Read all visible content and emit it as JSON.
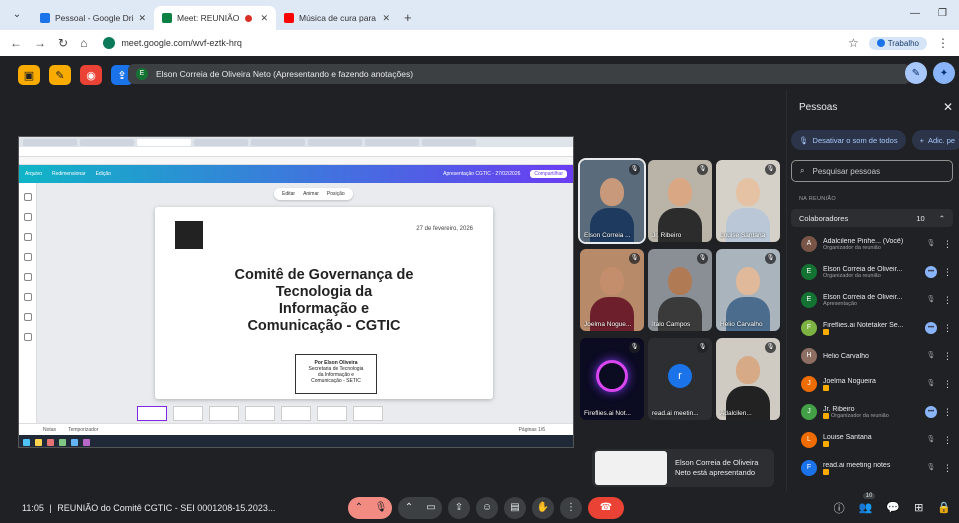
{
  "browser": {
    "tabs": [
      {
        "label": "Pessoal - Google Drive",
        "active": false,
        "color": "#1a73e8"
      },
      {
        "label": "Meet: REUNIÃO do Comitê",
        "active": true,
        "color": "#0b8043"
      },
      {
        "label": "Música de cura para o coração",
        "active": false,
        "color": "#ff0000"
      }
    ],
    "url": "meet.google.com/wvf-eztk-hrq",
    "profile_label": "Trabalho"
  },
  "meet": {
    "presenter_banner": "Elson Correia de Oliveira Neto (Apresentando e fazendo anotações)",
    "presenter_initial": "E",
    "presenting_card": {
      "line1": "Elson Correia de Oliveira",
      "line2": "Neto está apresentando"
    },
    "meeting_time": "11:05",
    "meeting_title": "REUNIÃO do Comitê CGTIC - SEI 0001208-15.2023...",
    "people_badge": "10"
  },
  "slide": {
    "date": "27 de fevereiro, 2026",
    "title_lines": [
      "Comitê de Governança de",
      "Tecnologia da",
      "Informação e",
      "Comunicação - CGTIC"
    ],
    "box_lines": [
      "Por Elson Oliveira",
      "Secretaria de Tecnologia",
      "da Informação e",
      "Comunicação - SETIC"
    ],
    "tools": [
      "Editar",
      "Animar",
      "Posição"
    ],
    "status_left": [
      "Notas",
      "Temporizador"
    ],
    "status_right": "Páginas 1/6",
    "canva_menu": [
      "Arquivo",
      "Redimensionar",
      "Edição"
    ],
    "canva_doc": "Apresentação CGTIC - 27/02/2026",
    "canva_share": "Compartilhar"
  },
  "tiles": [
    {
      "name": "Elson Correia ...",
      "sel": true,
      "bg": "#5a6b7c",
      "skin": "#c8997a",
      "shirt": "#1e3a5f"
    },
    {
      "name": "Jr. Ribeiro",
      "sel": false,
      "bg": "#b9b3a8",
      "skin": "#d9a784",
      "shirt": "#2c2c2c"
    },
    {
      "name": "Louise Santana",
      "sel": false,
      "bg": "#d5d0c8",
      "skin": "#e6c2a5",
      "shirt": "#b9c7d6"
    },
    {
      "name": "Joelma Nogue...",
      "sel": false,
      "bg": "#b78a6a",
      "skin": "#c48d6b",
      "shirt": "#6d1f2b"
    },
    {
      "name": "Ítalo Campos",
      "sel": false,
      "bg": "#8a8f96",
      "skin": "#b07a55",
      "shirt": "#3a3a3a"
    },
    {
      "name": "Helio Carvalho",
      "sel": false,
      "bg": "#a9b4bd",
      "skin": "#e0b89a",
      "shirt": "#4b6c8c"
    },
    {
      "name": "Fireflies.ai Not...",
      "sel": false,
      "type": "fireflies"
    },
    {
      "name": "read.ai meetin...",
      "sel": false,
      "type": "readai",
      "initial": "r"
    },
    {
      "name": "Adalcilen...",
      "sel": false,
      "bg": "#cfcac2",
      "skin": "#d6a987",
      "shirt": "#222"
    }
  ],
  "panel": {
    "title": "Pessoas",
    "mute_all": "Desativar o som de todos",
    "add": "Adic. pe",
    "search_placeholder": "Pesquisar pessoas",
    "section": "NA REUNIÃO",
    "group": "Colaboradores",
    "group_count": "10",
    "people": [
      {
        "name": "Adalcilene Pinhe... (Você)",
        "role": "Organizador da reunião",
        "initial": "A",
        "color": "#795548",
        "status": "mute",
        "badge": false
      },
      {
        "name": "Elson Correia de Oliveir...",
        "role": "Organizador da reunião",
        "initial": "E",
        "color": "#137333",
        "status": "dots",
        "badge": false
      },
      {
        "name": "Elson Correia de Oliveir...",
        "role": "Apresentação",
        "initial": "E",
        "color": "#137333",
        "status": "mute",
        "badge": false
      },
      {
        "name": "Fireflies.ai Notetaker Se...",
        "role": "",
        "initial": "F",
        "color": "#7cb342",
        "status": "dots",
        "badge": true
      },
      {
        "name": "Helio Carvalho",
        "role": "",
        "initial": "H",
        "color": "#8d6e63",
        "status": "mute",
        "badge": false
      },
      {
        "name": "Joelma Nogueira",
        "role": "",
        "initial": "J",
        "color": "#ef6c00",
        "status": "mute",
        "badge": true
      },
      {
        "name": "Jr. Ribeiro",
        "role": "Organizador da reunião",
        "initial": "J",
        "color": "#43a047",
        "status": "dots",
        "badge": true
      },
      {
        "name": "Louise Santana",
        "role": "",
        "initial": "L",
        "color": "#ef6c00",
        "status": "mute",
        "badge": true
      },
      {
        "name": "read.ai meeting notes",
        "role": "",
        "initial": "F",
        "color": "#1a73e8",
        "status": "mute",
        "badge": true
      }
    ]
  }
}
